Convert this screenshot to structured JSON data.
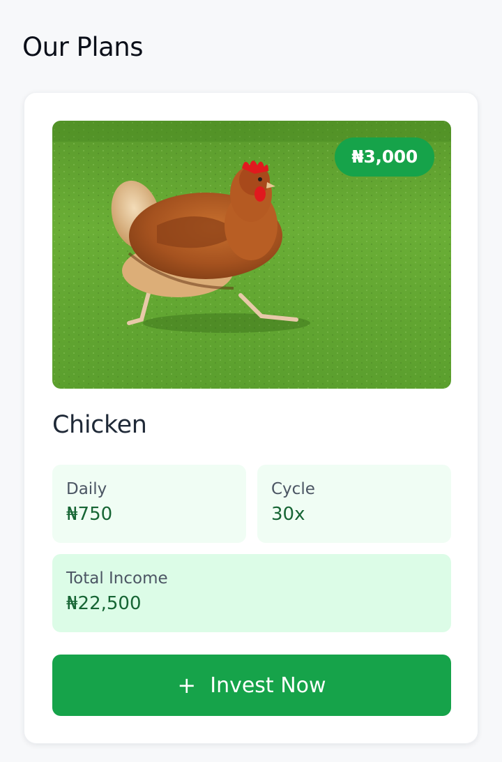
{
  "page": {
    "title": "Our Plans"
  },
  "plan": {
    "image_icon": "chicken-photo",
    "price": "₦3,000",
    "name": "Chicken",
    "daily": {
      "label": "Daily",
      "value": "₦750"
    },
    "cycle": {
      "label": "Cycle",
      "value": "30x"
    },
    "total_income": {
      "label": "Total Income",
      "value": "₦22,500"
    },
    "invest_button": {
      "icon": "plus-icon",
      "symbol": "+",
      "label": "Invest Now"
    }
  },
  "colors": {
    "accent": "#16a34a",
    "value_text": "#166534",
    "stat_bg": "#f0fdf4",
    "total_bg": "#dcfce7",
    "page_bg": "#f7f8fa"
  }
}
